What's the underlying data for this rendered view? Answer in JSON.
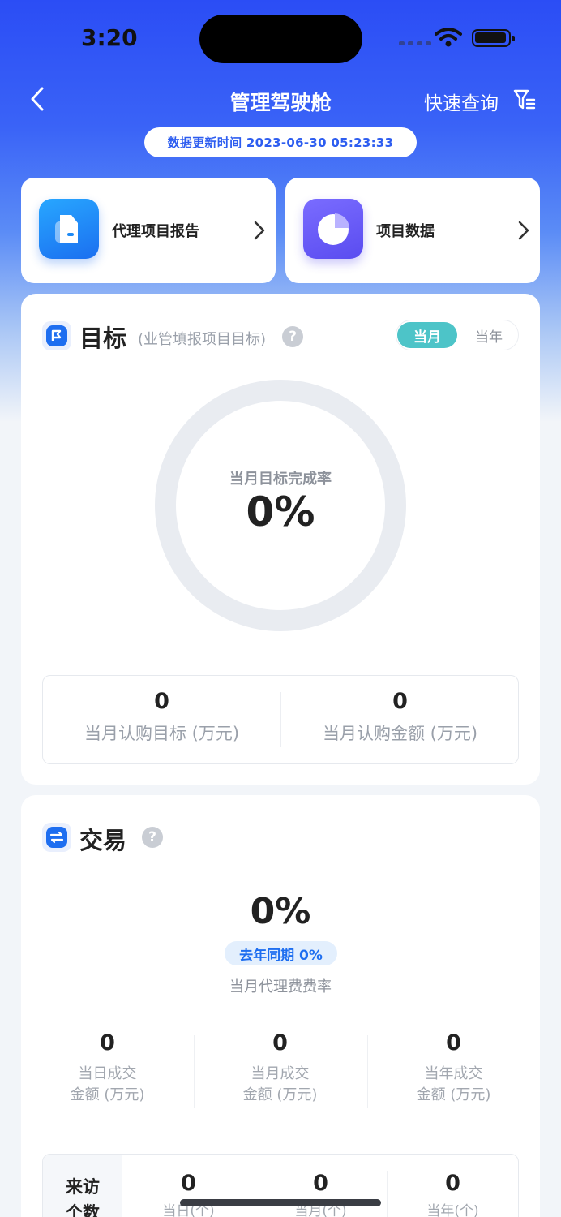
{
  "status_bar": {
    "time": "3:20"
  },
  "nav": {
    "title": "管理驾驶舱",
    "quick_query": "快速查询"
  },
  "update_time": "数据更新时间 2023-06-30 05:23:33",
  "entries": [
    {
      "label": "代理项目报告",
      "icon": "report-icon"
    },
    {
      "label": "项目数据",
      "icon": "pie-chart-icon"
    }
  ],
  "target": {
    "title": "目标",
    "subtitle": "(业管填报项目目标)",
    "toggle": {
      "active": "当月",
      "inactive": "当年"
    },
    "ring_label": "当月目标完成率",
    "ring_value": "0%",
    "completion": 0,
    "stats": [
      {
        "value": "0",
        "label": "当月认购目标 (万元)"
      },
      {
        "value": "0",
        "label": "当月认购金额 (万元)"
      }
    ]
  },
  "trade": {
    "title": "交易",
    "rate": "0%",
    "yoy": "去年同期 0%",
    "rate_caption": "当月代理费费率",
    "stats": [
      {
        "value": "0",
        "label_line1": "当日成交",
        "label_line2": "金额 (万元)"
      },
      {
        "value": "0",
        "label_line1": "当月成交",
        "label_line2": "金额 (万元)"
      },
      {
        "value": "0",
        "label_line1": "当年成交",
        "label_line2": "金额 (万元)"
      }
    ],
    "visits": {
      "head_line1": "来访",
      "head_line2": "个数",
      "cols": [
        {
          "value": "0",
          "label": "当日(个)"
        },
        {
          "value": "0",
          "label": "当月(个)"
        },
        {
          "value": "0",
          "label": "当年(个)"
        }
      ]
    }
  },
  "colors": {
    "primary": "#1e6ef0",
    "header": "#2b4df5",
    "toggle_active": "#4dc4c8"
  }
}
